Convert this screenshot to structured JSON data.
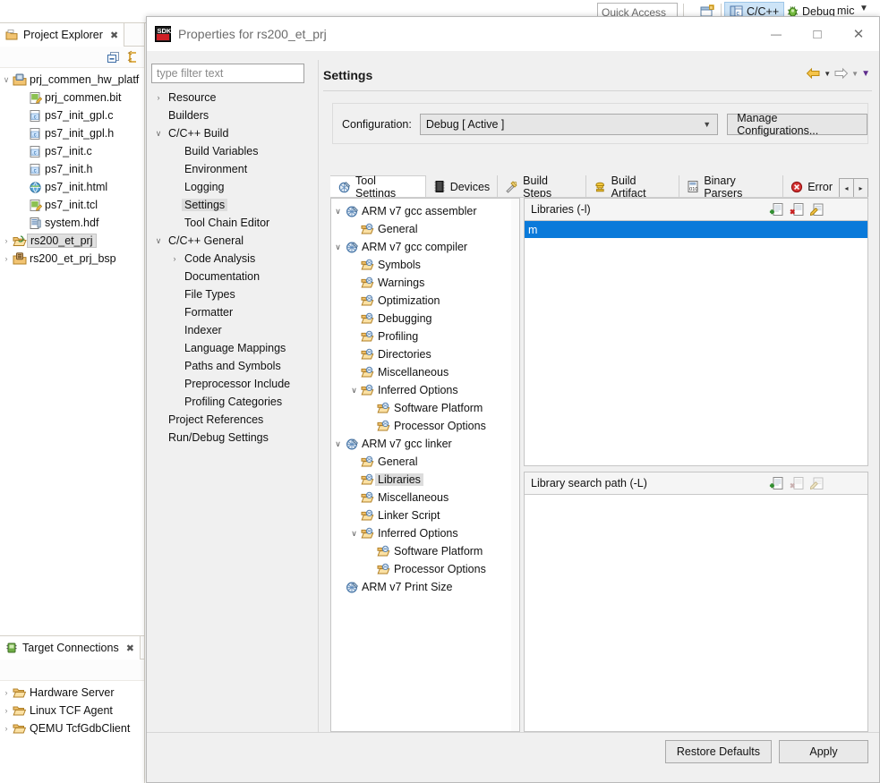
{
  "workbench": {
    "quick_access_placeholder": "Quick Access",
    "perspectives": [
      {
        "label": "C/C++",
        "icon": "cpp-perspective-icon",
        "active": true
      },
      {
        "label": "Debug",
        "icon": "debug-perspective-icon",
        "active": false
      }
    ],
    "perspective_clipped_label": "mic",
    "open_perspective_icon": "open-perspective-icon"
  },
  "project_explorer": {
    "tab_label": "Project Explorer",
    "tab_icon": "project-explorer-icon",
    "close_icon": "close-icon",
    "toolbar": [
      {
        "name": "collapse-all-icon"
      },
      {
        "name": "link-with-editor-icon"
      }
    ],
    "tree": [
      {
        "label": "prj_commen_hw_platf",
        "icon": "hw-platform-icon",
        "arrow": "expanded",
        "indent": 0,
        "selected": false
      },
      {
        "label": "prj_commen.bit",
        "icon": "bit-file-icon",
        "arrow": "none",
        "indent": 1,
        "selected": false
      },
      {
        "label": "ps7_init_gpl.c",
        "icon": "c-file-icon",
        "arrow": "none",
        "indent": 1,
        "selected": false
      },
      {
        "label": "ps7_init_gpl.h",
        "icon": "c-file-icon",
        "arrow": "none",
        "indent": 1,
        "selected": false
      },
      {
        "label": "ps7_init.c",
        "icon": "c-file-icon",
        "arrow": "none",
        "indent": 1,
        "selected": false
      },
      {
        "label": "ps7_init.h",
        "icon": "c-file-icon",
        "arrow": "none",
        "indent": 1,
        "selected": false
      },
      {
        "label": "ps7_init.html",
        "icon": "html-file-icon",
        "arrow": "none",
        "indent": 1,
        "selected": false
      },
      {
        "label": "ps7_init.tcl",
        "icon": "tcl-file-icon",
        "arrow": "none",
        "indent": 1,
        "selected": false
      },
      {
        "label": "system.hdf",
        "icon": "hdf-file-icon",
        "arrow": "none",
        "indent": 1,
        "selected": false
      },
      {
        "label": "rs200_et_prj",
        "icon": "project-open-icon",
        "arrow": "collapsed",
        "indent": 0,
        "selected": true
      },
      {
        "label": "rs200_et_prj_bsp",
        "icon": "bsp-project-icon",
        "arrow": "collapsed",
        "indent": 0,
        "selected": false
      }
    ]
  },
  "target_connections": {
    "tab_label": "Target Connections",
    "tab_icon": "target-connections-icon",
    "close_icon": "close-icon",
    "tree": [
      {
        "label": "Hardware Server",
        "icon": "folder-icon",
        "arrow": "collapsed"
      },
      {
        "label": "Linux TCF Agent",
        "icon": "folder-icon",
        "arrow": "collapsed"
      },
      {
        "label": "QEMU TcfGdbClient",
        "icon": "folder-icon",
        "arrow": "collapsed"
      }
    ]
  },
  "dialog": {
    "title": "Properties for rs200_et_prj",
    "title_icon": "sdk-icon",
    "window_controls": [
      {
        "name": "minimize-button",
        "glyph": "—"
      },
      {
        "name": "maximize-button",
        "glyph": "□"
      },
      {
        "name": "close-button",
        "glyph": "✕"
      }
    ],
    "filter": {
      "placeholder": "type filter text",
      "value": ""
    },
    "nav_tree": [
      {
        "label": "Resource",
        "arrow": "collapsed",
        "indent": 0,
        "selected": false
      },
      {
        "label": "Builders",
        "arrow": "none",
        "indent": 0,
        "selected": false
      },
      {
        "label": "C/C++ Build",
        "arrow": "expanded",
        "indent": 0,
        "selected": false
      },
      {
        "label": "Build Variables",
        "arrow": "none",
        "indent": 1,
        "selected": false
      },
      {
        "label": "Environment",
        "arrow": "none",
        "indent": 1,
        "selected": false
      },
      {
        "label": "Logging",
        "arrow": "none",
        "indent": 1,
        "selected": false
      },
      {
        "label": "Settings",
        "arrow": "none",
        "indent": 1,
        "selected": true
      },
      {
        "label": "Tool Chain Editor",
        "arrow": "none",
        "indent": 1,
        "selected": false
      },
      {
        "label": "C/C++ General",
        "arrow": "expanded",
        "indent": 0,
        "selected": false
      },
      {
        "label": "Code Analysis",
        "arrow": "collapsed",
        "indent": 1,
        "selected": false
      },
      {
        "label": "Documentation",
        "arrow": "none",
        "indent": 1,
        "selected": false
      },
      {
        "label": "File Types",
        "arrow": "none",
        "indent": 1,
        "selected": false
      },
      {
        "label": "Formatter",
        "arrow": "none",
        "indent": 1,
        "selected": false
      },
      {
        "label": "Indexer",
        "arrow": "none",
        "indent": 1,
        "selected": false
      },
      {
        "label": "Language Mappings",
        "arrow": "none",
        "indent": 1,
        "selected": false
      },
      {
        "label": "Paths and Symbols",
        "arrow": "none",
        "indent": 1,
        "selected": false
      },
      {
        "label": "Preprocessor Include",
        "arrow": "none",
        "indent": 1,
        "selected": false
      },
      {
        "label": "Profiling Categories",
        "arrow": "none",
        "indent": 1,
        "selected": false
      },
      {
        "label": "Project References",
        "arrow": "none",
        "indent": 0,
        "selected": false
      },
      {
        "label": "Run/Debug Settings",
        "arrow": "none",
        "indent": 0,
        "selected": false
      }
    ],
    "page": {
      "title": "Settings",
      "nav_icons": [
        {
          "name": "back-arrow-icon"
        },
        {
          "name": "back-dropdown-icon"
        },
        {
          "name": "forward-arrow-icon"
        },
        {
          "name": "forward-dropdown-icon"
        },
        {
          "name": "page-menu-icon"
        }
      ],
      "configuration_label": "Configuration:",
      "configuration_value": "Debug  [ Active ]",
      "manage_configurations_label": "Manage Configurations...",
      "tabs": [
        {
          "label": "Tool Settings",
          "icon": "tool-settings-icon",
          "active": true
        },
        {
          "label": "Devices",
          "icon": "devices-icon",
          "active": false
        },
        {
          "label": "Build Steps",
          "icon": "build-steps-icon",
          "active": false
        },
        {
          "label": "Build Artifact",
          "icon": "build-artifact-icon",
          "active": false
        },
        {
          "label": "Binary Parsers",
          "icon": "binary-parsers-icon",
          "active": false
        },
        {
          "label": "Error",
          "icon": "error-icon",
          "active": false
        }
      ],
      "tab_scroll_left": "◂",
      "tab_scroll_right": "▸",
      "tool_tree": [
        {
          "label": "ARM v7 gcc assembler",
          "icon": "tool-icon",
          "arrow": "expanded",
          "indent": 0,
          "selected": false
        },
        {
          "label": "General",
          "icon": "option-folder-icon",
          "arrow": "none",
          "indent": 1,
          "selected": false
        },
        {
          "label": "ARM v7 gcc compiler",
          "icon": "tool-icon",
          "arrow": "expanded",
          "indent": 0,
          "selected": false
        },
        {
          "label": "Symbols",
          "icon": "option-folder-icon",
          "arrow": "none",
          "indent": 1,
          "selected": false
        },
        {
          "label": "Warnings",
          "icon": "option-folder-icon",
          "arrow": "none",
          "indent": 1,
          "selected": false
        },
        {
          "label": "Optimization",
          "icon": "option-folder-icon",
          "arrow": "none",
          "indent": 1,
          "selected": false
        },
        {
          "label": "Debugging",
          "icon": "option-folder-icon",
          "arrow": "none",
          "indent": 1,
          "selected": false
        },
        {
          "label": "Profiling",
          "icon": "option-folder-icon",
          "arrow": "none",
          "indent": 1,
          "selected": false
        },
        {
          "label": "Directories",
          "icon": "option-folder-icon",
          "arrow": "none",
          "indent": 1,
          "selected": false
        },
        {
          "label": "Miscellaneous",
          "icon": "option-folder-icon",
          "arrow": "none",
          "indent": 1,
          "selected": false
        },
        {
          "label": "Inferred Options",
          "icon": "option-folder-icon",
          "arrow": "expanded",
          "indent": 1,
          "selected": false
        },
        {
          "label": "Software Platform",
          "icon": "option-folder-icon",
          "arrow": "none",
          "indent": 2,
          "selected": false
        },
        {
          "label": "Processor Options",
          "icon": "option-folder-icon",
          "arrow": "none",
          "indent": 2,
          "selected": false
        },
        {
          "label": "ARM v7 gcc linker",
          "icon": "tool-icon",
          "arrow": "expanded",
          "indent": 0,
          "selected": false
        },
        {
          "label": "General",
          "icon": "option-folder-icon",
          "arrow": "none",
          "indent": 1,
          "selected": false
        },
        {
          "label": "Libraries",
          "icon": "option-folder-icon",
          "arrow": "none",
          "indent": 1,
          "selected": true
        },
        {
          "label": "Miscellaneous",
          "icon": "option-folder-icon",
          "arrow": "none",
          "indent": 1,
          "selected": false
        },
        {
          "label": "Linker Script",
          "icon": "option-folder-icon",
          "arrow": "none",
          "indent": 1,
          "selected": false
        },
        {
          "label": "Inferred Options",
          "icon": "option-folder-icon",
          "arrow": "expanded",
          "indent": 1,
          "selected": false
        },
        {
          "label": "Software Platform",
          "icon": "option-folder-icon",
          "arrow": "none",
          "indent": 2,
          "selected": false
        },
        {
          "label": "Processor Options",
          "icon": "option-folder-icon",
          "arrow": "none",
          "indent": 2,
          "selected": false
        },
        {
          "label": "ARM v7 Print Size",
          "icon": "tool-icon",
          "arrow": "none",
          "indent": 0,
          "selected": false
        }
      ],
      "libraries_panel": {
        "title": "Libraries (-l)",
        "tools": [
          {
            "name": "add-icon",
            "enabled": true
          },
          {
            "name": "delete-icon",
            "enabled": true
          },
          {
            "name": "edit-icon",
            "enabled": true
          },
          {
            "name": "move-up-icon",
            "enabled": false
          },
          {
            "name": "move-down-icon",
            "enabled": false
          }
        ],
        "items": [
          {
            "value": "m",
            "selected": true
          }
        ]
      },
      "library_search_path_panel": {
        "title": "Library search path (-L)",
        "tools": [
          {
            "name": "add-icon",
            "enabled": true
          },
          {
            "name": "delete-icon",
            "enabled": false
          },
          {
            "name": "edit-icon",
            "enabled": false
          },
          {
            "name": "move-up-icon",
            "enabled": false
          },
          {
            "name": "move-down-icon",
            "enabled": false
          }
        ],
        "items": []
      }
    },
    "footer": {
      "restore_defaults_label": "Restore Defaults",
      "apply_label": "Apply"
    }
  },
  "colors": {
    "selection_blue": "#0a7ada",
    "tree_selection_gray": "#dcdcdc",
    "dialog_bg": "#f0f0f0",
    "accent_orange": "#e0a010"
  }
}
